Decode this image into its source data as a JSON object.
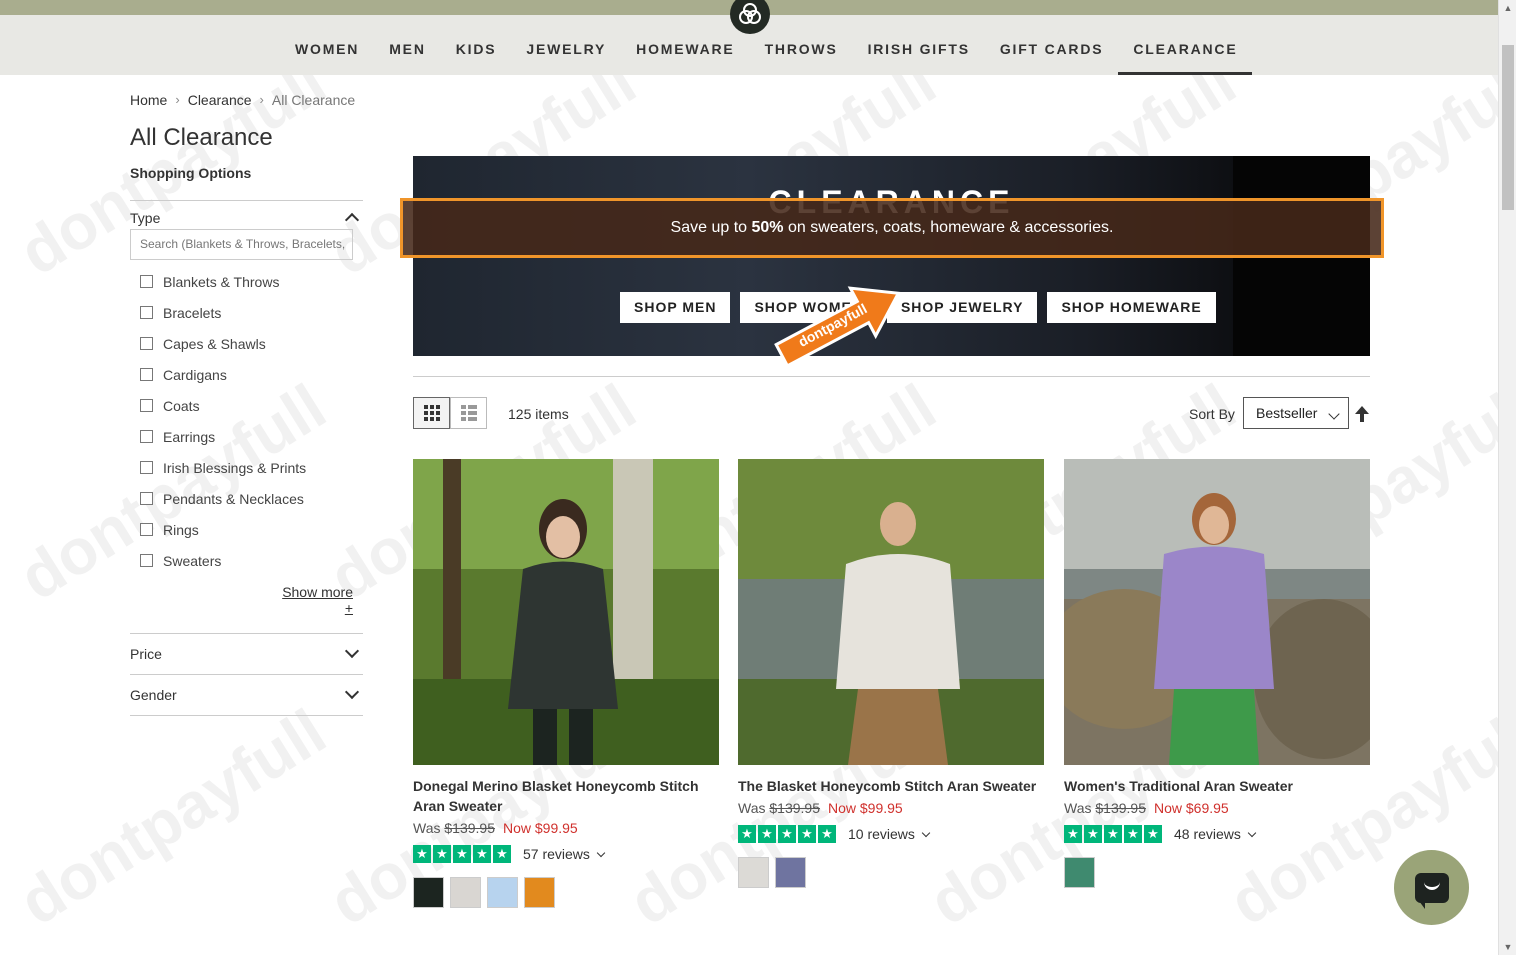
{
  "nav": {
    "items": [
      "WOMEN",
      "MEN",
      "KIDS",
      "JEWELRY",
      "HOMEWARE",
      "THROWS",
      "IRISH GIFTS",
      "GIFT CARDS",
      "CLEARANCE"
    ],
    "active": "CLEARANCE"
  },
  "breadcrumb": [
    "Home",
    "Clearance",
    "All Clearance"
  ],
  "page": {
    "title": "All Clearance",
    "shopping_options": "Shopping Options"
  },
  "filters": {
    "type": {
      "label": "Type",
      "search_placeholder": "Search (Blankets & Throws, Bracelets,",
      "options": [
        "Blankets & Throws",
        "Bracelets",
        "Capes & Shawls",
        "Cardigans",
        "Coats",
        "Earrings",
        "Irish Blessings & Prints",
        "Pendants & Necklaces",
        "Rings",
        "Sweaters"
      ],
      "show_more": "Show more",
      "show_more_plus": "+"
    },
    "price": {
      "label": "Price"
    },
    "gender": {
      "label": "Gender"
    }
  },
  "banner": {
    "title": "CLEARANCE",
    "promo_prefix": "Save up to ",
    "promo_bold": "50%",
    "promo_suffix": " on sweaters, coats, homeware & accessories.",
    "buttons": [
      "SHOP MEN",
      "SHOP WOMEN",
      "SHOP JEWELRY",
      "SHOP HOMEWARE"
    ],
    "sticker_text": "dontpayfull"
  },
  "toolbar": {
    "items_count": "125 items",
    "sort_label": "Sort By",
    "sort_value": "Bestseller"
  },
  "products": [
    {
      "name": "Donegal Merino Blasket Honeycomb Stitch Aran Sweater",
      "was_label": "Was ",
      "was": "$139.95",
      "now": "Now $99.95",
      "reviews": "57 reviews",
      "swatches": [
        "#1c2520",
        "#d9d6d2",
        "#b7d3ee",
        "#e28a1e"
      ]
    },
    {
      "name": "The Blasket Honeycomb Stitch Aran Sweater",
      "was_label": "Was ",
      "was": "$139.95",
      "now": "Now $99.95",
      "reviews": "10 reviews",
      "swatches": [
        "#dcdad6",
        "#6f74a0"
      ]
    },
    {
      "name": "Women's Traditional Aran Sweater",
      "was_label": "Was ",
      "was": "$139.95",
      "now": "Now $69.95",
      "reviews": "48 reviews",
      "swatches": [
        "#3f8a6f"
      ]
    }
  ],
  "watermark": "dontpayfull",
  "colors": {
    "topbar": "#a9ad8e",
    "navbar": "#e8e8e4",
    "promo_border": "#f0952a",
    "price_now": "#d0312d",
    "trustpilot": "#00b67a",
    "chat": "#9aa478"
  }
}
